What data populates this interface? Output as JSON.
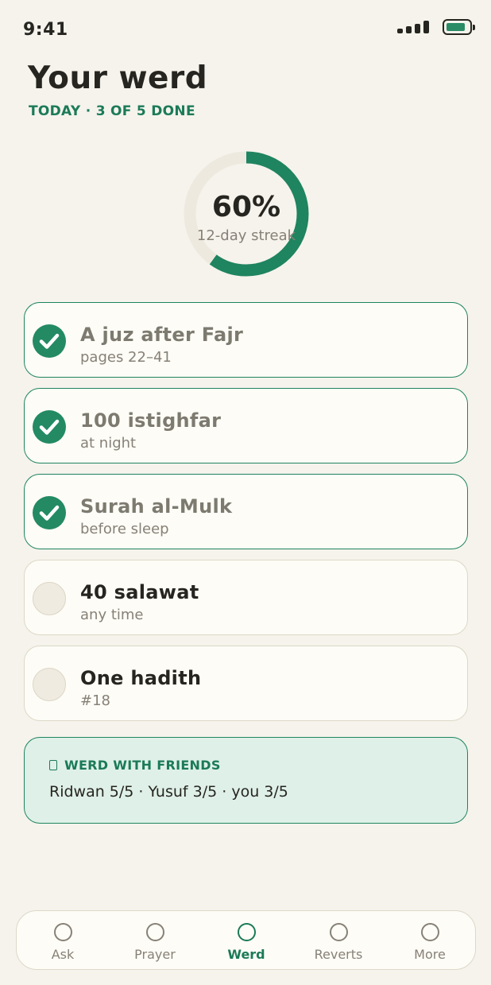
{
  "status_bar": {
    "time": "9:41"
  },
  "header": {
    "title": "Your werd",
    "subtitle": "TODAY · 3 OF 5 DONE"
  },
  "progress": {
    "fraction": 0.6,
    "percent_label": "60%",
    "streak_label": "12-day streak",
    "color": "#1f8460",
    "track_color": "#ede9df"
  },
  "tasks": [
    {
      "title": "A juz after Fajr",
      "subtitle": "pages 22–41",
      "done": true
    },
    {
      "title": "100 istighfar",
      "subtitle": "at night",
      "done": true
    },
    {
      "title": "Surah al-Mulk",
      "subtitle": "before sleep",
      "done": true
    },
    {
      "title": "40 salawat",
      "subtitle": "any time",
      "done": false
    },
    {
      "title": "One hadith",
      "subtitle": "#18",
      "done": false
    }
  ],
  "friends": {
    "heading": "WERD WITH FRIENDS",
    "icon": "group-icon",
    "text": "Ridwan 5/5 · Yusuf 3/5 · you 3/5"
  },
  "tabbar": {
    "active": "Werd",
    "tabs": [
      {
        "label": "Ask",
        "icon": "ask-icon"
      },
      {
        "label": "Prayer",
        "icon": "prayer-icon"
      },
      {
        "label": "Werd",
        "icon": "werd-icon"
      },
      {
        "label": "Reverts",
        "icon": "reverts-icon"
      },
      {
        "label": "More",
        "icon": "more-icon"
      }
    ]
  },
  "colors": {
    "accent": "#1f8460",
    "background": "#f5f3ec",
    "card": "#fdfcf6",
    "friends_bg": "#dff0e8"
  }
}
